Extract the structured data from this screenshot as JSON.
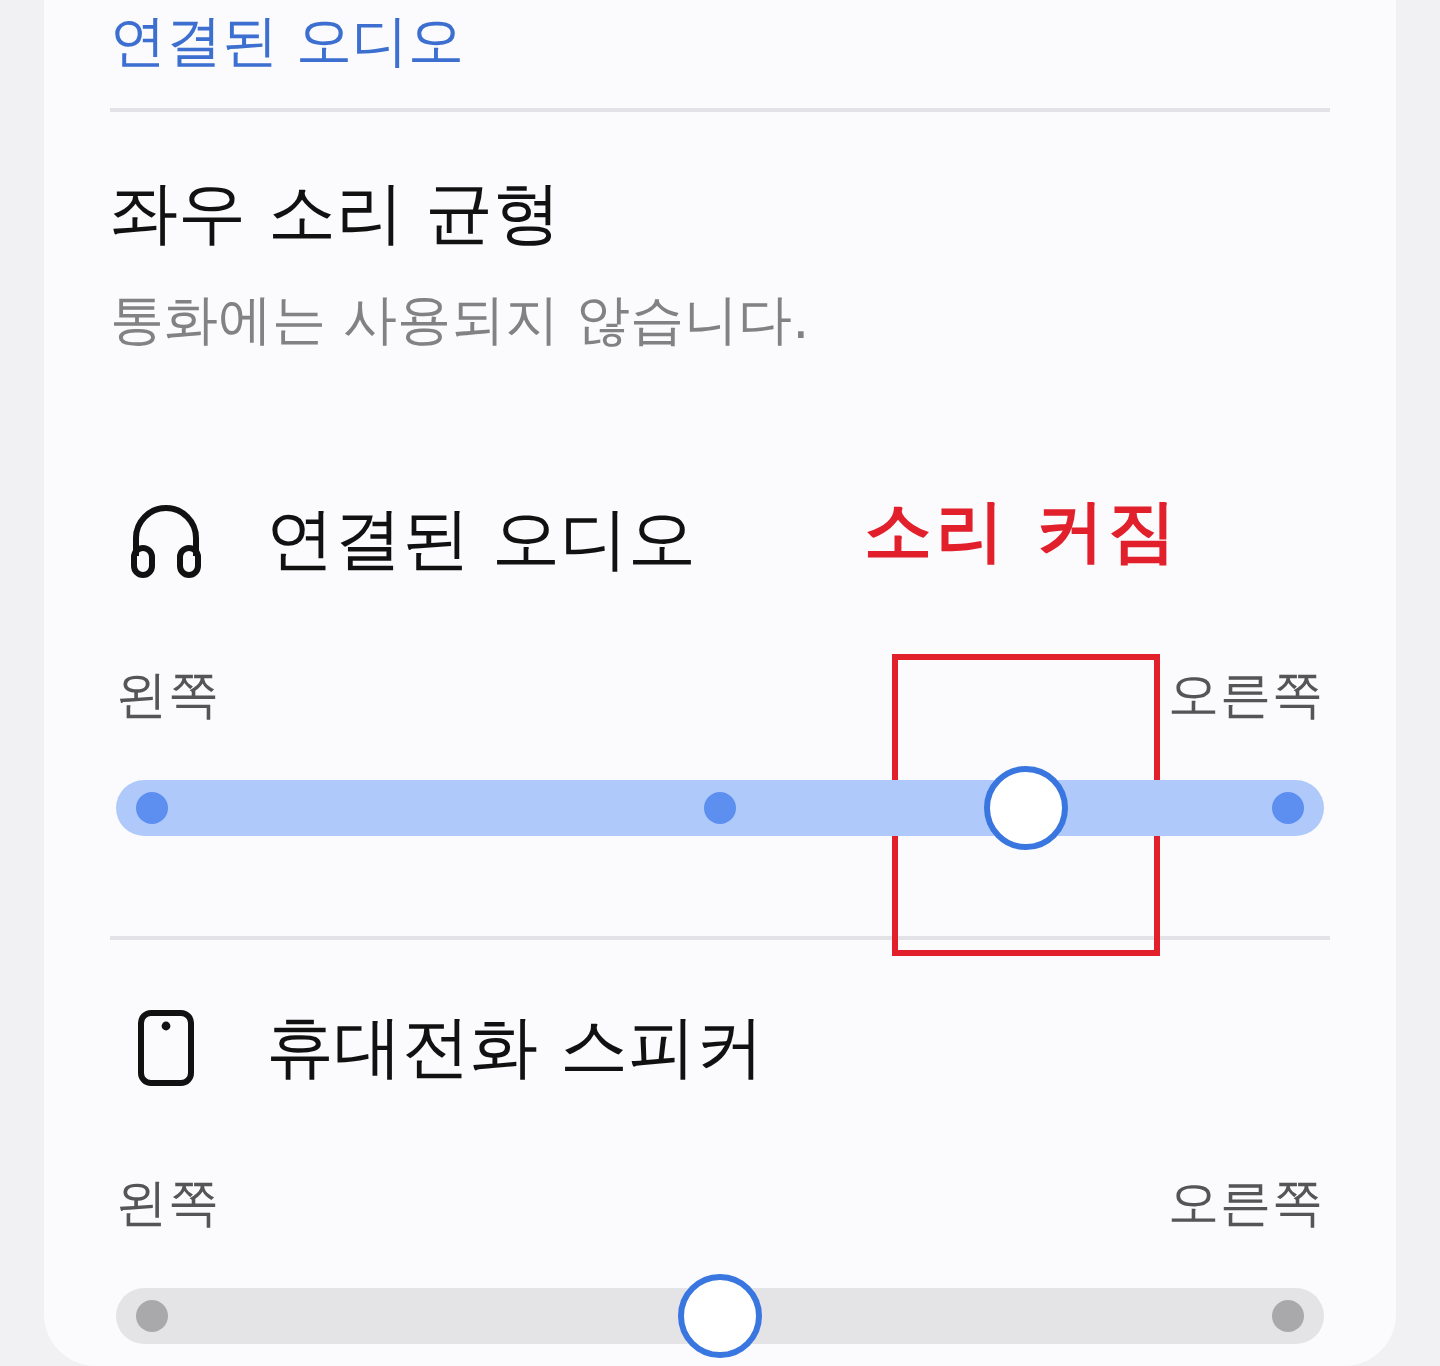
{
  "top_item": {
    "label": "연결된 오디오"
  },
  "balance": {
    "title": "좌우 소리 균형",
    "subtitle": "통화에는 사용되지 않습니다."
  },
  "devices": [
    {
      "kind": "headphones",
      "name": "연결된 오디오",
      "annotation": {
        "text": "소리 커짐"
      },
      "left_label": "왼쪽",
      "right_label": "오른쪽",
      "active": true,
      "level": 0.77
    },
    {
      "kind": "phone",
      "name": "휴대전화 스피커",
      "left_label": "왼쪽",
      "right_label": "오른쪽",
      "active": false,
      "level": 0.5
    }
  ]
}
